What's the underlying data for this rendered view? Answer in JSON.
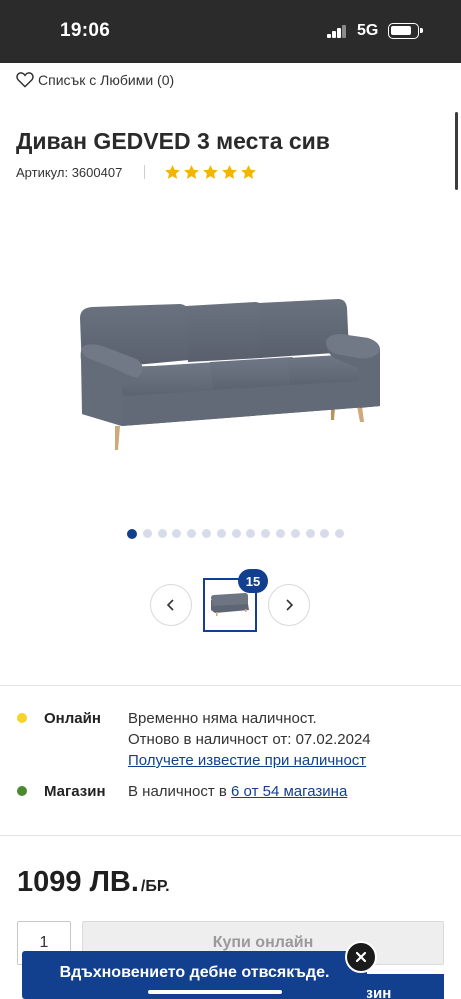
{
  "status_bar": {
    "time": "19:06",
    "network": "5G"
  },
  "favorites": {
    "label": "Списък с Любими (0)"
  },
  "product": {
    "title": "Диван GEDVED 3 места сив",
    "sku": "Артикул: 3600407",
    "rating": 5,
    "rating_max": 5
  },
  "gallery": {
    "image_count": 15,
    "active_index": 1,
    "thumb_badge": "15"
  },
  "availability": {
    "online": {
      "label": "Онлайн",
      "status_color": "#f5d327",
      "line1": "Временно няма наличност.",
      "line2": "Отново в наличност от: 07.02.2024",
      "notify_link": "Получете известие при наличност"
    },
    "store": {
      "label": "Магазин",
      "status_color": "#4a8a2c",
      "text_prefix": "В наличност в ",
      "stores_link": "6 от 54 магазина"
    }
  },
  "price": {
    "amount": "1099 ЛВ.",
    "unit": "/БР."
  },
  "purchase": {
    "quantity": "1",
    "buy_online_label": "Купи онлайн",
    "buy_store_label": "азин"
  },
  "toast": {
    "text": "Вдъхновението дебне отвсякъде."
  },
  "colors": {
    "brand": "#12408f",
    "star": "#f5b400"
  }
}
